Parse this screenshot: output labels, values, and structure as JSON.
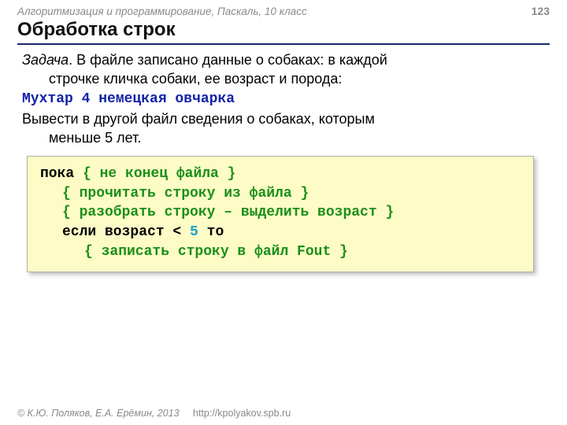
{
  "header": {
    "course": "Алгоритмизация и программирование, Паскаль, 10 класс",
    "page": "123"
  },
  "title": "Обработка строк",
  "task": {
    "label": "Задача",
    "line1_rest": ". В файле записано данные о собаках: в каждой",
    "line2": "строчке кличка собаки, ее возраст и порода:",
    "example": "Мухтар 4 немецкая овчарка",
    "line3": "Вывести в другой файл сведения о собаках, которым",
    "line4": "меньше 5 лет."
  },
  "code": {
    "l1_kw": "пока ",
    "l1_cmt": "{ не конец файла }",
    "l2_cmt": "{ прочитать строку из файла }",
    "l3_cmt": "{ разобрать строку – выделить возраст }",
    "l4_kw1": "если возраст < ",
    "l4_num": "5",
    "l4_kw2": " то",
    "l5_cmt": "{ записать строку в файл Fout }"
  },
  "footer": {
    "copyright": "© К.Ю. Поляков, Е.А. Ерёмин, 2013",
    "url": "http://kpolyakov.spb.ru"
  }
}
